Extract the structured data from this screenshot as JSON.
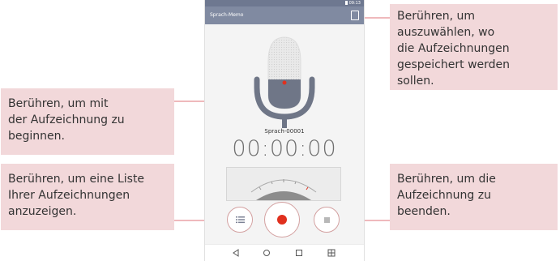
{
  "phone": {
    "status_time": "09:13",
    "app_title": "Sprach-Memo",
    "recording_name": "Sprach-00001",
    "timer": "00:00:00"
  },
  "callouts": {
    "storage": [
      "Berühren, um",
      "auszuwählen, wo",
      "die Aufzeichnungen",
      "gespeichert werden sollen."
    ],
    "start": [
      "Berühren, um mit",
      "der Aufzeichnung zu",
      "beginnen."
    ],
    "list": [
      "Berühren, um eine Liste",
      "Ihrer Aufzeichnungen",
      "anzuzeigen."
    ],
    "stop": [
      "Berühren, um die",
      "Aufzeichnung zu",
      "beenden."
    ]
  },
  "colors": {
    "callout_bg": "#f2d8da",
    "leader_line": "#efb9bc",
    "appbar": "#808aa1",
    "record_red": "#e0301e"
  },
  "icons": [
    "storage-icon",
    "microphone-icon",
    "list-icon",
    "record-icon",
    "stop-icon",
    "back-icon",
    "home-icon",
    "recent-apps-icon",
    "dual-window-icon"
  ]
}
